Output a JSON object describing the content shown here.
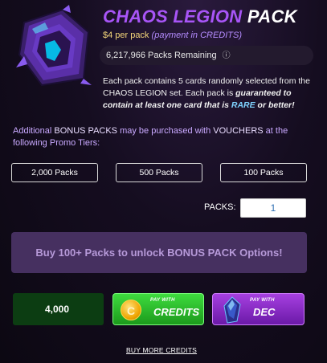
{
  "header": {
    "title_main": "CHAOS LEGION",
    "title_suffix": "PACK",
    "price": "$4 per pack",
    "price_note": "(payment in CREDITS)",
    "remaining": "6,217,966 Packs Remaining",
    "info_icon": "info-icon"
  },
  "description": {
    "line1": "Each pack contains 5 cards randomly selected from the CHAOS LEGION set. Each pack is ",
    "guaranteed": "guaranteed to contain at least one card that is ",
    "rare": "RARE",
    "or_better": " or better!"
  },
  "bonus": {
    "text_before": "Additional ",
    "bonus_packs": "BONUS PACKS",
    "text_mid": " may be purchased with ",
    "vouchers": "VOUCHERS",
    "text_after": " at the following Promo Tiers:"
  },
  "tiers": [
    {
      "label": "2,000 Packs"
    },
    {
      "label": "500 Packs"
    },
    {
      "label": "100 Packs"
    }
  ],
  "quantity": {
    "label": "PACKS:",
    "value": "1"
  },
  "unlock_message": "Buy 100+ Packs to unlock BONUS PACK Options!",
  "payment": {
    "balance": "4,000",
    "credits": {
      "small": "PAY WITH",
      "big": "CREDITS",
      "icon": "credits-coin-icon"
    },
    "dec": {
      "small": "PAY WITH",
      "big": "DEC",
      "icon": "dec-gem-icon"
    }
  },
  "footer": {
    "buy_more": "BUY MORE CREDITS"
  },
  "colors": {
    "title_purple": "#a855f7",
    "price_gold": "#f5d77a",
    "credits_green": "#2fbd2f",
    "dec_purple": "#8a2dc7",
    "unlock_bg": "#463060"
  }
}
